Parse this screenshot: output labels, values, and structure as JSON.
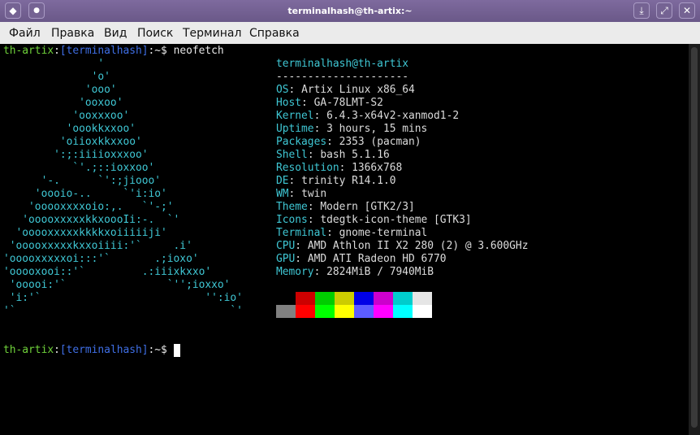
{
  "window": {
    "title": "terminalhash@th-artix:~"
  },
  "titlebar_buttons": {
    "menu_glyph": "◆",
    "pin_glyph": "●",
    "minimize_glyph": "⤓",
    "maximize_glyph": "⤢",
    "close_glyph": "✕"
  },
  "menu": [
    "Файл",
    "Правка",
    "Вид",
    "Поиск",
    "Терминал",
    "Справка"
  ],
  "prompt": {
    "host": "th-artix",
    "sep": ":",
    "user": "[terminalhash]",
    "path": ":~",
    "dollar": "$",
    "command": "neofetch"
  },
  "logo_lines": [
    "               '",
    "              'o'",
    "             'ooo'",
    "            'ooxoo'",
    "           'ooxxxoo'",
    "          'oookkxxoo'",
    "         'oiioxkkxxoo'",
    "        ':;:iiiioxxxoo'",
    "           `'.;::ioxxoo'",
    "      '-.      `':;jiooo'",
    "     'oooio-..     `'i:io'",
    "    'ooooxxxxoio:,.   `'-;'",
    "   'ooooxxxxxkkxoooIi:-.  `'",
    "  'ooooxxxxxkkkkxoiiiiiji'",
    " 'ooooxxxxxkxxoiiii:'`     .i'",
    "'ooooxxxxxoi:::'`       .;ioxo'",
    "'ooooxooi::'`         .:iiixkxxo'",
    " 'ooooi:'`                `'';ioxxo'",
    " 'i:'`                          '':io'",
    "'`                                  `'"
  ],
  "info": {
    "header": "terminalhash@th-artix",
    "rule": "---------------------",
    "rows": [
      {
        "key": "OS",
        "value": "Artix Linux x86_64"
      },
      {
        "key": "Host",
        "value": "GA-78LMT-S2"
      },
      {
        "key": "Kernel",
        "value": "6.4.3-x64v2-xanmod1-2"
      },
      {
        "key": "Uptime",
        "value": "3 hours, 15 mins"
      },
      {
        "key": "Packages",
        "value": "2353 (pacman)"
      },
      {
        "key": "Shell",
        "value": "bash 5.1.16"
      },
      {
        "key": "Resolution",
        "value": "1366x768"
      },
      {
        "key": "DE",
        "value": "trinity R14.1.0"
      },
      {
        "key": "WM",
        "value": "twin"
      },
      {
        "key": "Theme",
        "value": "Modern [GTK2/3]"
      },
      {
        "key": "Icons",
        "value": "tdegtk-icon-theme [GTK3]"
      },
      {
        "key": "Terminal",
        "value": "gnome-terminal"
      },
      {
        "key": "CPU",
        "value": "AMD Athlon II X2 280 (2) @ 3.600GHz"
      },
      {
        "key": "GPU",
        "value": "AMD ATI Radeon HD 6770"
      },
      {
        "key": "Memory",
        "value": "2824MiB / 7940MiB"
      }
    ]
  },
  "palette": {
    "row1": [
      "#000000",
      "#cc0000",
      "#00cc00",
      "#cccc00",
      "#0000e6",
      "#cc00cc",
      "#00cccc",
      "#e5e5e5"
    ],
    "row2": [
      "#808080",
      "#ff0000",
      "#00ff00",
      "#ffff00",
      "#5c5cff",
      "#ff00ff",
      "#00ffff",
      "#ffffff"
    ]
  }
}
